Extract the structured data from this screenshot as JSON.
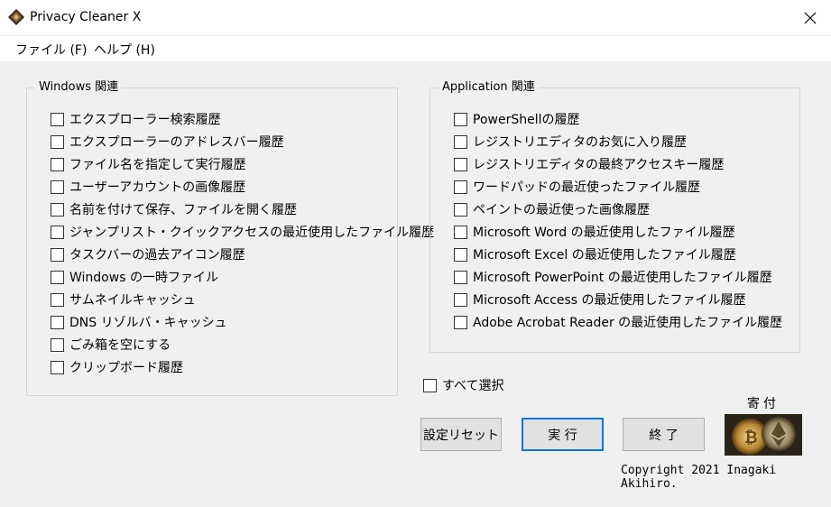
{
  "window": {
    "title": "Privacy Cleaner X"
  },
  "menu": {
    "file": "ファイル (F)",
    "help": "ヘルプ (H)"
  },
  "windows_group": {
    "title": "Windows 関連",
    "items": [
      "エクスプローラー検索履歴",
      "エクスプローラーのアドレスバー履歴",
      "ファイル名を指定して実行履歴",
      "ユーザーアカウントの画像履歴",
      "名前を付けて保存、ファイルを開く履歴",
      "ジャンプリスト・クイックアクセスの最近使用したファイル履歴",
      "タスクバーの過去アイコン履歴",
      "Windows の一時ファイル",
      "サムネイルキャッシュ",
      "DNS リゾルバ・キャッシュ",
      "ごみ箱を空にする",
      "クリップボード履歴"
    ]
  },
  "app_group": {
    "title": "Application 関連",
    "items": [
      "PowerShellの履歴",
      "レジストリエディタのお気に入り履歴",
      "レジストリエディタの最終アクセスキー履歴",
      "ワードパッドの最近使ったファイル履歴",
      "ペイントの最近使った画像履歴",
      "Microsoft Word の最近使用したファイル履歴",
      "Microsoft Excel の最近使用したファイル履歴",
      "Microsoft PowerPoint の最近使用したファイル履歴",
      "Microsoft Access の最近使用したファイル履歴",
      "Adobe Acrobat Reader の最近使用したファイル履歴"
    ]
  },
  "select_all": "すべて選択",
  "buttons": {
    "reset": "設定リセット",
    "run": "実 行",
    "exit": "終 了"
  },
  "donate": {
    "label": "寄付",
    "icon": "bitcoin-ethereum-coins"
  },
  "copyright": "Copyright 2021 Inagaki Akihiro.",
  "colors": {
    "accent": "#0078d7",
    "background": "#f0f0f0"
  }
}
